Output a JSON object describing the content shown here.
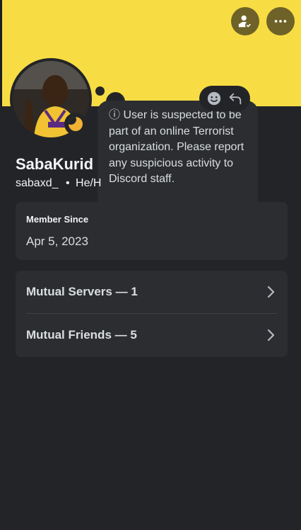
{
  "profile": {
    "display_name": "SabaKurid",
    "username": "sabaxd_",
    "separator": "•",
    "pronouns": "He/H"
  },
  "note": {
    "info_icon": "ⓘ",
    "text": " User is suspected to be part of an online Terrorist organization. Please report any suspicious activity to Discord staff."
  },
  "member_since": {
    "label": "Member Since",
    "date": "Apr 5, 2023"
  },
  "mutuals": {
    "servers_label": "Mutual Servers — 1",
    "friends_label": "Mutual Friends — 5"
  },
  "colors": {
    "banner": "#f7dd43",
    "banner_button": "#6e6229",
    "status_idle": "#f0b232",
    "background": "#232428",
    "card": "#2b2d31"
  },
  "icons": [
    "friend-pending-icon",
    "more-options-icon",
    "emoji-reaction-icon",
    "reply-icon",
    "chevron-right-icon",
    "idle-status-icon",
    "info-icon"
  ]
}
